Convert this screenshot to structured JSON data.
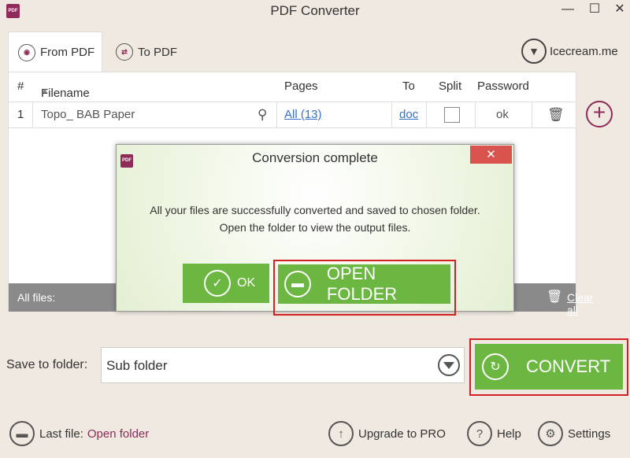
{
  "window": {
    "title": "PDF Converter",
    "logo_text": "PDF",
    "min_glyph": "—",
    "max_glyph": "☐",
    "close_glyph": "✕"
  },
  "tabs": [
    {
      "label": "From PDF",
      "icon": "pdf-icon",
      "active": true
    },
    {
      "label": "To PDF",
      "icon": "convert-icon",
      "active": false
    }
  ],
  "brand": {
    "label": "Icecream.me",
    "icon": "icecream-icon"
  },
  "table": {
    "headers": {
      "num": "#",
      "filename": "Filename",
      "pages": "Pages",
      "to": "To",
      "split": "Split",
      "password": "Password"
    },
    "rows": [
      {
        "num": "1",
        "filename": "Topo_ BAB Paper",
        "pages": "All (13)",
        "to": "doc",
        "split": false,
        "password": "ok"
      }
    ],
    "footer_label": "All files:",
    "clear_all": "Clear all"
  },
  "save": {
    "label": "Save to folder:",
    "value": "Sub folder"
  },
  "convert": {
    "label": "CONVERT"
  },
  "bottom": {
    "last_file_label": "Last file:",
    "open_folder_link": "Open folder",
    "upgrade": "Upgrade to PRO",
    "help": "Help",
    "settings": "Settings"
  },
  "modal": {
    "title": "Conversion complete",
    "logo_text": "PDF",
    "close_glyph": "✕",
    "message_line1": "All your files are successfully converted and saved to chosen folder.",
    "message_line2": "Open the folder to view the output files.",
    "ok_label": "OK",
    "open_folder_label": "OPEN FOLDER"
  },
  "colors": {
    "accent": "#6cb642",
    "brand": "#8e2b59",
    "highlight": "#d42020",
    "link": "#3572c4"
  }
}
